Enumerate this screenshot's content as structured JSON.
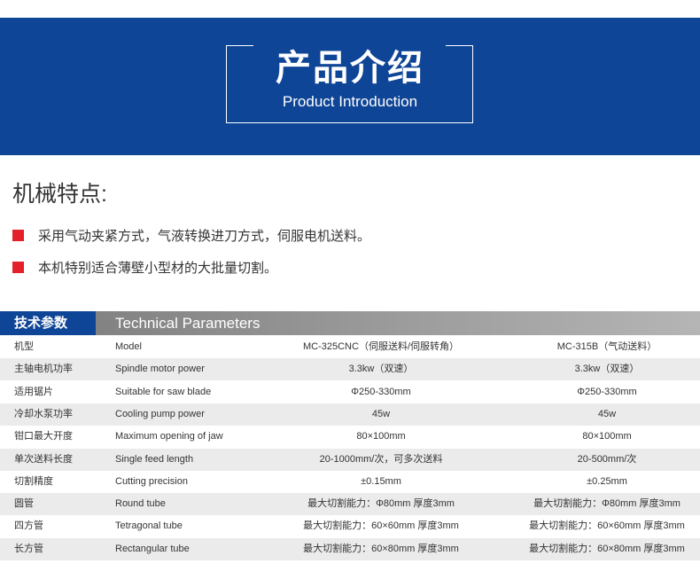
{
  "banner": {
    "title_cn": "产品介绍",
    "title_en": "Product Introduction",
    "bg_color": "#0f4596"
  },
  "features": {
    "heading": "机械特点:",
    "bullet_color": "#e2212b",
    "items": [
      "采用气动夹紧方式，气液转换进刀方式，伺服电机送料。",
      "本机特别适合薄壁小型材的大批量切割。"
    ]
  },
  "specs": {
    "header_cn": "技术参数",
    "header_en": "Technical Parameters",
    "rows": [
      {
        "cn": "机型",
        "en": "Model",
        "a": "MC-325CNC（伺服送料/伺服转角）",
        "b": "MC-315B（气动送料）"
      },
      {
        "cn": "主轴电机功率",
        "en": "Spindle motor power",
        "a": "3.3kw（双速）",
        "b": "3.3kw（双速）"
      },
      {
        "cn": "适用锯片",
        "en": "Suitable for saw blade",
        "a": "Φ250-330mm",
        "b": "Φ250-330mm"
      },
      {
        "cn": "冷却水泵功率",
        "en": "Cooling pump power",
        "a": "45w",
        "b": "45w"
      },
      {
        "cn": "钳口最大开度",
        "en": "Maximum opening of jaw",
        "a": "80×100mm",
        "b": "80×100mm"
      },
      {
        "cn": "单次送料长度",
        "en": "Single feed length",
        "a": "20-1000mm/次，可多次送料",
        "b": "20-500mm/次"
      },
      {
        "cn": "切割精度",
        "en": "Cutting precision",
        "a": "±0.15mm",
        "b": "±0.25mm"
      },
      {
        "cn": "圆管",
        "en": "Round tube",
        "a": "最大切割能力：Φ80mm  厚度3mm",
        "b": "最大切割能力：Φ80mm  厚度3mm"
      },
      {
        "cn": "四方管",
        "en": "Tetragonal tube",
        "a": "最大切割能力：60×60mm  厚度3mm",
        "b": "最大切割能力：60×60mm  厚度3mm"
      },
      {
        "cn": "长方管",
        "en": "Rectangular tube",
        "a": "最大切割能力：60×80mm  厚度3mm",
        "b": "最大切割能力：60×80mm  厚度3mm"
      }
    ]
  }
}
